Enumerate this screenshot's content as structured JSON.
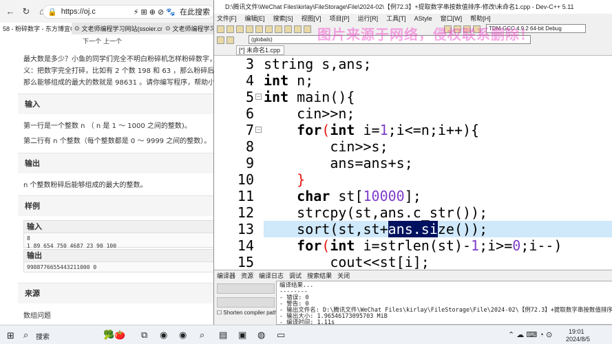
{
  "browser": {
    "url": "https://oj.c",
    "search_label": "在此搜索",
    "tabs": [
      {
        "label": "58 - 粉碎数字 - 东方博宜OJ",
        "close": "×"
      },
      {
        "label": "文老师编程学习网站(ssoier.cn)",
        "close": "×"
      },
      {
        "label": "文老师编程学习"
      }
    ],
    "bookmarks": [
      "下一个",
      "上一个"
    ],
    "intro_lines": [
      "最大数是多少？小鱼的同学们完全不明白粉碎机怎样粉碎数字，小鱼",
      "义：把数字完全打碎，比如有 2 个数 198 和 63 ，那么粉碎后有数",
      "那么能够组成的最大的数就是 98631 。请你编写程序，帮助小鱼同学"
    ],
    "sections": {
      "input": {
        "title": "输入",
        "line1": "第一行是一个整数 n （ n 是 1 ～ 1000 之间的整数)。",
        "line2": "第二行有 n 个整数（每个整数都是 0 ～ 9999 之间的整数）。"
      },
      "output": {
        "title": "输出",
        "line1": "n 个整数粉碎后能够组成的最大的整数。"
      },
      "sample": {
        "title": "样例",
        "input_head": "输入",
        "input_l1": "8",
        "input_l2": "1 89 654 750 4687 23 90 100",
        "output_head": "输出",
        "output_l1": "9988776655443211000 0"
      },
      "source": {
        "title": "来源",
        "line1": "数组问题"
      }
    }
  },
  "ide": {
    "title": "D:\\腾讯文件\\WeChat Files\\kirlay\\FileStorage\\File\\2024-02\\【例72.3】+提取数字串按数值排序-修改\\未命名1.cpp - Dev-C++ 5.11",
    "menu": [
      "文件[F]",
      "编辑[E]",
      "搜索[S]",
      "视图[V]",
      "项目[P]",
      "运行[R]",
      "工具[T]",
      "AStyle",
      "窗口[W]",
      "帮助[H]"
    ],
    "compiler": "TDM-GCC 4.9.2 64-bit Debug",
    "scope": "(globals)",
    "file_tab": "[*] 未命名1.cpp",
    "watermark": "图片来源于网络，侵权联系删除！",
    "line_numbers": [
      "3",
      "4",
      "5",
      "6",
      "7",
      "8",
      "9",
      "10",
      "11",
      "12",
      "13",
      "14",
      "15"
    ],
    "code": {
      "l3": "string s,ans;",
      "l4a": "int",
      "l4b": " n;",
      "l5a": "int",
      "l5b": " main(){",
      "l6": "    cin>>n;",
      "l7a": "    for",
      "l7b": "(",
      "l7c": "int",
      "l7d": " i=",
      "l7e": "1",
      "l7f": ";i<=n;i++){",
      "l8": "        cin>>s;",
      "l9": "        ans=ans+s;",
      "l10": "    }",
      "l11a": "    char",
      "l11b": " st[",
      "l11c": "10000",
      "l11d": "];",
      "l12": "    strcpy(st,ans.c_str());",
      "l13a": "    sort(st,st+",
      "l13b": "ans.si",
      "l13c": "ze());",
      "l14a": "    for",
      "l14b": "(",
      "l14c": "int",
      "l14d": " i=strlen(st)-",
      "l14e": "1",
      "l14f": ";i>=",
      "l14g": "0",
      "l14h": ";i--)",
      "l15": "        cout<<st[i];"
    },
    "bottom_tabs": [
      "编译器",
      "资源",
      "编译日志",
      "调试",
      "搜索结果",
      "关闭"
    ],
    "shorten_label": "Shorten compiler paths",
    "log": "编译结果...\n--------\n- 错误: 0\n- 警告: 0\n- 输出文件名: D:\\腾讯文件\\WeChat Files\\kirlay\\FileStorage\\File\\2024-02\\【例72.3】+提取数字串按数值排序-修\n- 输出大小: 1.96546173095703 MiB\n- 编译时间: 1.11s"
  },
  "taskbar": {
    "search": "搜索",
    "time": "19:01",
    "date": "2024/8/5"
  }
}
